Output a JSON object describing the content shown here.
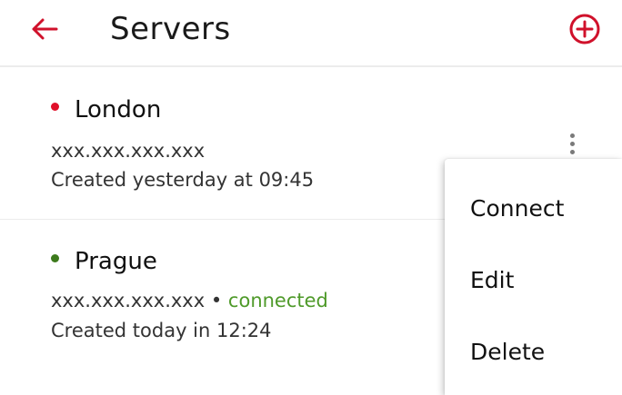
{
  "app_bar": {
    "title": "Servers",
    "back_icon": "arrow-left-icon",
    "add_icon": "plus-circle-icon"
  },
  "colors": {
    "accent": "#d0112b",
    "online": "#3d7a1c",
    "connected_text": "#4f9a2a",
    "offline_dot": "#e0102a"
  },
  "servers": [
    {
      "name": "London",
      "address": "xxx.xxx.xxx.xxx",
      "status_text": "",
      "created": "Created yesterday at 09:45",
      "dot_color": "#e0102a"
    },
    {
      "name": "Prague",
      "address": "xxx.xxx.xxx.xxx",
      "separator": "•",
      "status_text": "connected",
      "created": "Created today in 12:24",
      "dot_color": "#3d7a1c"
    }
  ],
  "context_menu": {
    "items": [
      {
        "label": "Connect"
      },
      {
        "label": "Edit"
      },
      {
        "label": "Delete"
      }
    ]
  },
  "more_icon": "more-vertical-icon"
}
